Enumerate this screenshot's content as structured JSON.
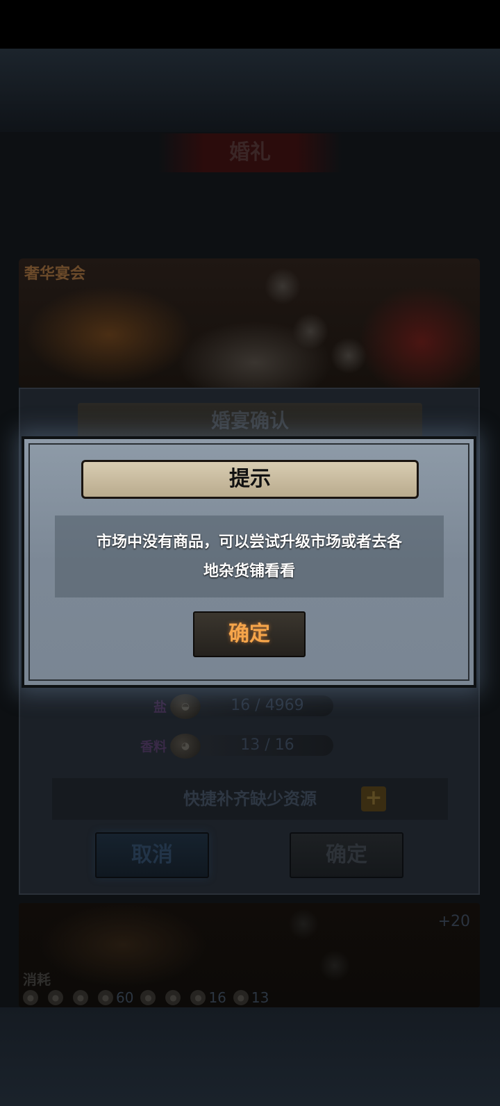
{
  "scene": {
    "title": "婚礼"
  },
  "banner": {
    "title": "奢华宴会"
  },
  "panel": {
    "header": "婚宴确认",
    "resources": [
      {
        "label": "盐",
        "icon": "salt-pile-icon",
        "value": "16 / 4969"
      },
      {
        "label": "香料",
        "icon": "spice-sack-icon",
        "value": "13 / 16"
      }
    ],
    "quick_fill_label": "快捷补齐缺少资源",
    "quick_fill_plus": "+",
    "cancel_label": "取消",
    "confirm_label": "确定"
  },
  "footer": {
    "reward": "+20",
    "cost_label": "消耗",
    "costs": [
      {
        "icon": "food-icon",
        "value": ""
      },
      {
        "icon": "meat-icon",
        "value": ""
      },
      {
        "icon": "wine-icon",
        "value": ""
      },
      {
        "icon": "fish-icon",
        "value": "60"
      },
      {
        "icon": "bread-icon",
        "value": ""
      },
      {
        "icon": "dessert-icon",
        "value": ""
      },
      {
        "icon": "salt-icon",
        "value": "16"
      },
      {
        "icon": "spice-icon",
        "value": "13"
      }
    ]
  },
  "modal": {
    "title": "提示",
    "message_line1": "市场中没有商品，可以尝试升级市场或者去各",
    "message_line2": "地杂货铺看看",
    "ok_label": "确定"
  },
  "colors": {
    "modal_ok_text": "#f6a54a",
    "modal_background": "#8e9ba8"
  }
}
